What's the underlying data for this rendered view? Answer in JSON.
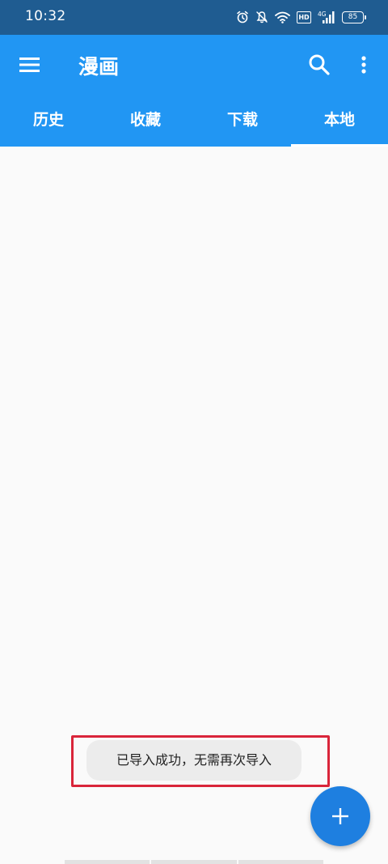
{
  "status_bar": {
    "time": "10:32",
    "icons": [
      "alarm-icon",
      "bell-off-icon",
      "wifi-icon",
      "hd-icon",
      "4g-signal-icon",
      "battery-icon"
    ],
    "hd_label": "HD",
    "network_label": "4G",
    "battery_level": "85"
  },
  "app_bar": {
    "title": "漫画",
    "menu_icon": "hamburger-menu-icon",
    "search_icon": "search-icon",
    "more_icon": "more-vert-icon",
    "color": "#2196f3"
  },
  "tabs": [
    {
      "label": "历史",
      "active": false
    },
    {
      "label": "收藏",
      "active": false
    },
    {
      "label": "下载",
      "active": false
    },
    {
      "label": "本地",
      "active": true
    }
  ],
  "toast": {
    "message": "已导入成功，无需再次导入",
    "highlight_color": "#d9253a"
  },
  "fab": {
    "icon": "plus-icon",
    "color": "#1e7fe0"
  }
}
